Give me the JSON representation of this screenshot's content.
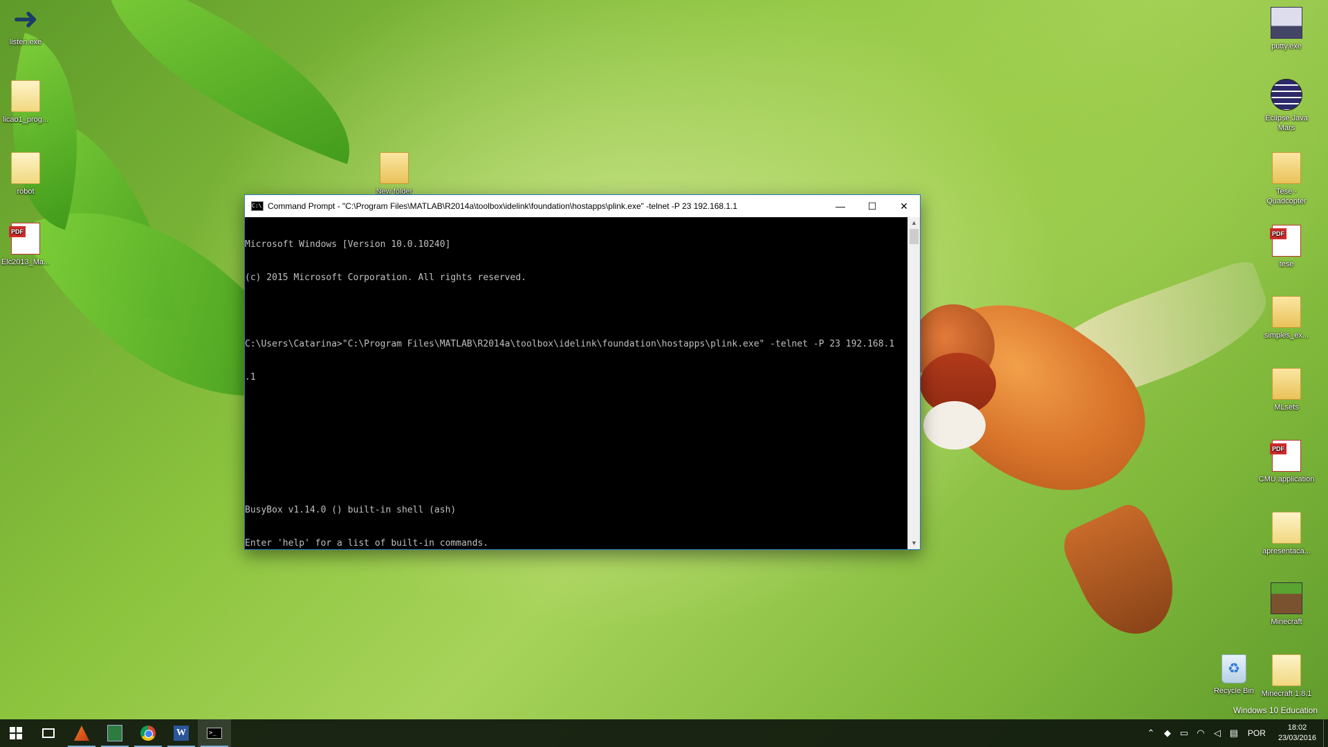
{
  "desktop": {
    "left_icons": [
      {
        "label": "listen.exe",
        "kind": "arrow"
      },
      {
        "label": "licao1_prog...",
        "kind": "doc"
      },
      {
        "label": "robot",
        "kind": "doc"
      },
      {
        "label": "Elc2013_Ma...",
        "kind": "pdf"
      }
    ],
    "center_icons": [
      {
        "label": "New folder",
        "kind": "folder"
      }
    ],
    "right_icons": [
      {
        "label": "putty.exe",
        "kind": "putty"
      },
      {
        "label": "Eclipse Java Mars",
        "kind": "eclipse"
      },
      {
        "label": "Tese - Quadcopter",
        "kind": "folder"
      },
      {
        "label": "tese",
        "kind": "pdf"
      },
      {
        "label": "simples_ex...",
        "kind": "folder"
      },
      {
        "label": "MLsets",
        "kind": "folder"
      },
      {
        "label": "CMU application",
        "kind": "pdf"
      },
      {
        "label": "apresentaca...",
        "kind": "doc"
      },
      {
        "label": "Minecraft",
        "kind": "minecraft"
      },
      {
        "label": "Recycle Bin",
        "kind": "recycle"
      },
      {
        "label": "Minecraft 1.8.1",
        "kind": "doc"
      }
    ],
    "watermark": "Windows 10 Education"
  },
  "cmd_window": {
    "title": "Command Prompt - \"C:\\Program Files\\MATLAB\\R2014a\\toolbox\\idelink\\foundation\\hostapps\\plink.exe\"  -telnet -P 23 192.168.1.1",
    "minimize_symbol": "—",
    "maximize_symbol": "☐",
    "close_symbol": "✕",
    "lines": [
      "Microsoft Windows [Version 10.0.10240]",
      "(c) 2015 Microsoft Corporation. All rights reserved.",
      "",
      "C:\\Users\\Catarina>\"C:\\Program Files\\MATLAB\\R2014a\\toolbox\\idelink\\foundation\\hostapps\\plink.exe\" -telnet -P 23 192.168.1",
      ".1",
      "",
      "",
      "",
      "BusyBox v1.14.0 () built-in shell (ash)",
      "Enter 'help' for a list of built-in commands.",
      "",
      "# "
    ],
    "scroll_up": "▲",
    "scroll_down": "▼"
  },
  "taskbar": {
    "apps": [
      {
        "name": "start-button",
        "icon": "windows-logo-icon"
      },
      {
        "name": "task-view-button",
        "icon": "task-view-icon"
      },
      {
        "name": "taskbar-matlab",
        "icon": "matlab-icon"
      },
      {
        "name": "taskbar-excel",
        "icon": "excel-icon"
      },
      {
        "name": "taskbar-chrome",
        "icon": "chrome-icon"
      },
      {
        "name": "taskbar-word",
        "icon": "word-icon",
        "glyph": "W"
      },
      {
        "name": "taskbar-cmd",
        "icon": "cmd-icon",
        "glyph": ">_"
      }
    ],
    "tray": {
      "language": "POR",
      "time": "18:02",
      "date": "23/03/2016"
    }
  },
  "colors": {
    "accent": "#2b79c5",
    "console_bg": "#000000",
    "console_fg": "#c0c0c0",
    "taskbar_bg": "#10180e"
  }
}
